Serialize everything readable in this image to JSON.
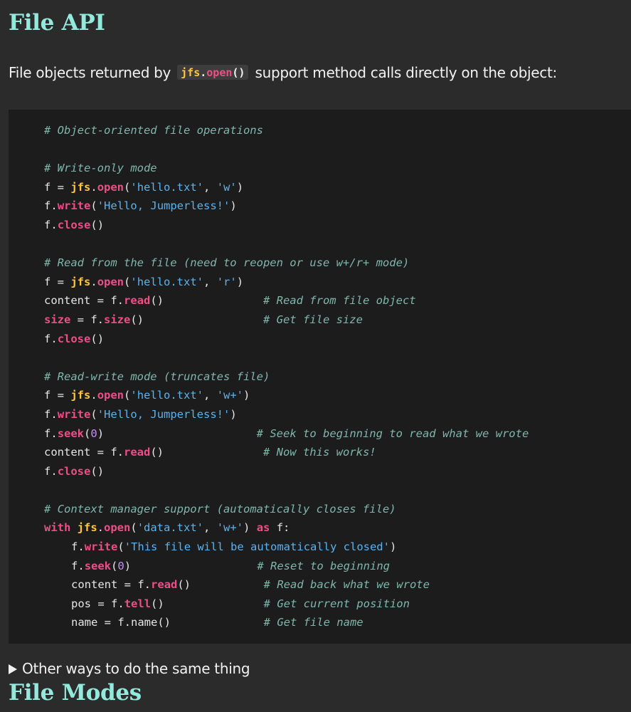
{
  "section_title": "File API",
  "intro": {
    "before": "File objects returned by",
    "code_module": "jfs",
    "code_dot": ".",
    "code_func": "open",
    "code_parens": "()",
    "after": "support method calls directly on the object:"
  },
  "code": {
    "c_title": "# Object-oriented file operations",
    "c_write_only": "# Write-only mode",
    "c_read": "# Read from the file (need to reopen or use w+/r+ mode)",
    "c_read_obj": "# Read from file object",
    "c_get_size": "# Get file size",
    "c_rw": "# Read-write mode (truncates file)",
    "c_seek": "# Seek to beginning to read what we wrote",
    "c_now_works": "# Now this works!",
    "c_ctx": "# Context manager support (automatically closes file)",
    "c_reset": "# Reset to beginning",
    "c_read_back": "# Read back what we wrote",
    "c_pos": "# Get current position",
    "c_name": "# Get file name",
    "f": "f",
    "content": "content",
    "size": "size",
    "pos": "pos",
    "name": "name",
    "jfs": "jfs",
    "open": "open",
    "write": "write",
    "close": "close",
    "read": "read",
    "size_fn": "size",
    "seek": "seek",
    "tell": "tell",
    "name_fn": "name",
    "with": "with",
    "as": "as",
    "s_hello": "'hello.txt'",
    "s_w": "'w'",
    "s_r": "'r'",
    "s_wplus": "'w+'",
    "s_hello_j": "'Hello, Jumperless!'",
    "s_data": "'data.txt'",
    "s_auto": "'This file will be automatically closed'",
    "zero": "0"
  },
  "details_label": "Other ways to do the same thing",
  "next_section_title": "File Modes"
}
